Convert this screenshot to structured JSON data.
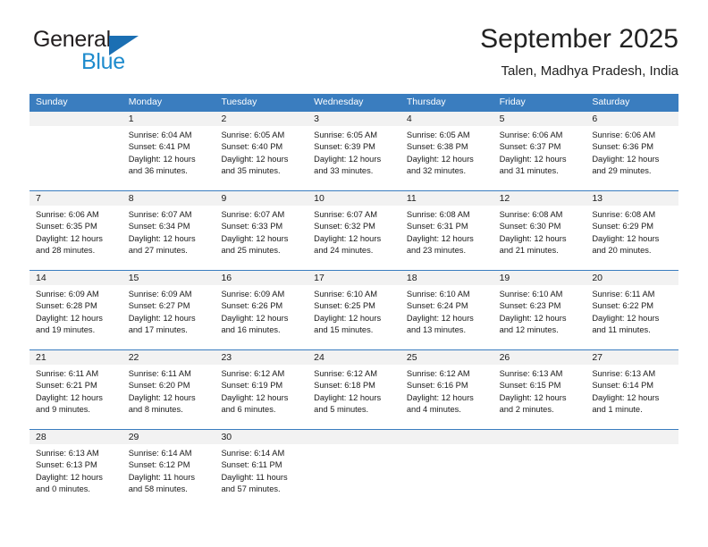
{
  "brand": {
    "name_part1": "General",
    "name_part2": "Blue",
    "triangle_color": "#1b6fb3",
    "blue_text_color": "#1e8bcd"
  },
  "header": {
    "title": "September 2025",
    "subtitle": "Talen, Madhya Pradesh, India"
  },
  "theme": {
    "header_blue": "#3a7dbf",
    "day_band_gray": "#f2f2f2",
    "text_color": "#1a1a1a"
  },
  "weekdays": [
    "Sunday",
    "Monday",
    "Tuesday",
    "Wednesday",
    "Thursday",
    "Friday",
    "Saturday"
  ],
  "weeks": [
    [
      {
        "day": "",
        "sunrise": "",
        "sunset": "",
        "daylight_1": "",
        "daylight_2": ""
      },
      {
        "day": "1",
        "sunrise": "Sunrise: 6:04 AM",
        "sunset": "Sunset: 6:41 PM",
        "daylight_1": "Daylight: 12 hours",
        "daylight_2": "and 36 minutes."
      },
      {
        "day": "2",
        "sunrise": "Sunrise: 6:05 AM",
        "sunset": "Sunset: 6:40 PM",
        "daylight_1": "Daylight: 12 hours",
        "daylight_2": "and 35 minutes."
      },
      {
        "day": "3",
        "sunrise": "Sunrise: 6:05 AM",
        "sunset": "Sunset: 6:39 PM",
        "daylight_1": "Daylight: 12 hours",
        "daylight_2": "and 33 minutes."
      },
      {
        "day": "4",
        "sunrise": "Sunrise: 6:05 AM",
        "sunset": "Sunset: 6:38 PM",
        "daylight_1": "Daylight: 12 hours",
        "daylight_2": "and 32 minutes."
      },
      {
        "day": "5",
        "sunrise": "Sunrise: 6:06 AM",
        "sunset": "Sunset: 6:37 PM",
        "daylight_1": "Daylight: 12 hours",
        "daylight_2": "and 31 minutes."
      },
      {
        "day": "6",
        "sunrise": "Sunrise: 6:06 AM",
        "sunset": "Sunset: 6:36 PM",
        "daylight_1": "Daylight: 12 hours",
        "daylight_2": "and 29 minutes."
      }
    ],
    [
      {
        "day": "7",
        "sunrise": "Sunrise: 6:06 AM",
        "sunset": "Sunset: 6:35 PM",
        "daylight_1": "Daylight: 12 hours",
        "daylight_2": "and 28 minutes."
      },
      {
        "day": "8",
        "sunrise": "Sunrise: 6:07 AM",
        "sunset": "Sunset: 6:34 PM",
        "daylight_1": "Daylight: 12 hours",
        "daylight_2": "and 27 minutes."
      },
      {
        "day": "9",
        "sunrise": "Sunrise: 6:07 AM",
        "sunset": "Sunset: 6:33 PM",
        "daylight_1": "Daylight: 12 hours",
        "daylight_2": "and 25 minutes."
      },
      {
        "day": "10",
        "sunrise": "Sunrise: 6:07 AM",
        "sunset": "Sunset: 6:32 PM",
        "daylight_1": "Daylight: 12 hours",
        "daylight_2": "and 24 minutes."
      },
      {
        "day": "11",
        "sunrise": "Sunrise: 6:08 AM",
        "sunset": "Sunset: 6:31 PM",
        "daylight_1": "Daylight: 12 hours",
        "daylight_2": "and 23 minutes."
      },
      {
        "day": "12",
        "sunrise": "Sunrise: 6:08 AM",
        "sunset": "Sunset: 6:30 PM",
        "daylight_1": "Daylight: 12 hours",
        "daylight_2": "and 21 minutes."
      },
      {
        "day": "13",
        "sunrise": "Sunrise: 6:08 AM",
        "sunset": "Sunset: 6:29 PM",
        "daylight_1": "Daylight: 12 hours",
        "daylight_2": "and 20 minutes."
      }
    ],
    [
      {
        "day": "14",
        "sunrise": "Sunrise: 6:09 AM",
        "sunset": "Sunset: 6:28 PM",
        "daylight_1": "Daylight: 12 hours",
        "daylight_2": "and 19 minutes."
      },
      {
        "day": "15",
        "sunrise": "Sunrise: 6:09 AM",
        "sunset": "Sunset: 6:27 PM",
        "daylight_1": "Daylight: 12 hours",
        "daylight_2": "and 17 minutes."
      },
      {
        "day": "16",
        "sunrise": "Sunrise: 6:09 AM",
        "sunset": "Sunset: 6:26 PM",
        "daylight_1": "Daylight: 12 hours",
        "daylight_2": "and 16 minutes."
      },
      {
        "day": "17",
        "sunrise": "Sunrise: 6:10 AM",
        "sunset": "Sunset: 6:25 PM",
        "daylight_1": "Daylight: 12 hours",
        "daylight_2": "and 15 minutes."
      },
      {
        "day": "18",
        "sunrise": "Sunrise: 6:10 AM",
        "sunset": "Sunset: 6:24 PM",
        "daylight_1": "Daylight: 12 hours",
        "daylight_2": "and 13 minutes."
      },
      {
        "day": "19",
        "sunrise": "Sunrise: 6:10 AM",
        "sunset": "Sunset: 6:23 PM",
        "daylight_1": "Daylight: 12 hours",
        "daylight_2": "and 12 minutes."
      },
      {
        "day": "20",
        "sunrise": "Sunrise: 6:11 AM",
        "sunset": "Sunset: 6:22 PM",
        "daylight_1": "Daylight: 12 hours",
        "daylight_2": "and 11 minutes."
      }
    ],
    [
      {
        "day": "21",
        "sunrise": "Sunrise: 6:11 AM",
        "sunset": "Sunset: 6:21 PM",
        "daylight_1": "Daylight: 12 hours",
        "daylight_2": "and 9 minutes."
      },
      {
        "day": "22",
        "sunrise": "Sunrise: 6:11 AM",
        "sunset": "Sunset: 6:20 PM",
        "daylight_1": "Daylight: 12 hours",
        "daylight_2": "and 8 minutes."
      },
      {
        "day": "23",
        "sunrise": "Sunrise: 6:12 AM",
        "sunset": "Sunset: 6:19 PM",
        "daylight_1": "Daylight: 12 hours",
        "daylight_2": "and 6 minutes."
      },
      {
        "day": "24",
        "sunrise": "Sunrise: 6:12 AM",
        "sunset": "Sunset: 6:18 PM",
        "daylight_1": "Daylight: 12 hours",
        "daylight_2": "and 5 minutes."
      },
      {
        "day": "25",
        "sunrise": "Sunrise: 6:12 AM",
        "sunset": "Sunset: 6:16 PM",
        "daylight_1": "Daylight: 12 hours",
        "daylight_2": "and 4 minutes."
      },
      {
        "day": "26",
        "sunrise": "Sunrise: 6:13 AM",
        "sunset": "Sunset: 6:15 PM",
        "daylight_1": "Daylight: 12 hours",
        "daylight_2": "and 2 minutes."
      },
      {
        "day": "27",
        "sunrise": "Sunrise: 6:13 AM",
        "sunset": "Sunset: 6:14 PM",
        "daylight_1": "Daylight: 12 hours",
        "daylight_2": "and 1 minute."
      }
    ],
    [
      {
        "day": "28",
        "sunrise": "Sunrise: 6:13 AM",
        "sunset": "Sunset: 6:13 PM",
        "daylight_1": "Daylight: 12 hours",
        "daylight_2": "and 0 minutes."
      },
      {
        "day": "29",
        "sunrise": "Sunrise: 6:14 AM",
        "sunset": "Sunset: 6:12 PM",
        "daylight_1": "Daylight: 11 hours",
        "daylight_2": "and 58 minutes."
      },
      {
        "day": "30",
        "sunrise": "Sunrise: 6:14 AM",
        "sunset": "Sunset: 6:11 PM",
        "daylight_1": "Daylight: 11 hours",
        "daylight_2": "and 57 minutes."
      },
      {
        "day": "",
        "sunrise": "",
        "sunset": "",
        "daylight_1": "",
        "daylight_2": ""
      },
      {
        "day": "",
        "sunrise": "",
        "sunset": "",
        "daylight_1": "",
        "daylight_2": ""
      },
      {
        "day": "",
        "sunrise": "",
        "sunset": "",
        "daylight_1": "",
        "daylight_2": ""
      },
      {
        "day": "",
        "sunrise": "",
        "sunset": "",
        "daylight_1": "",
        "daylight_2": ""
      }
    ]
  ]
}
